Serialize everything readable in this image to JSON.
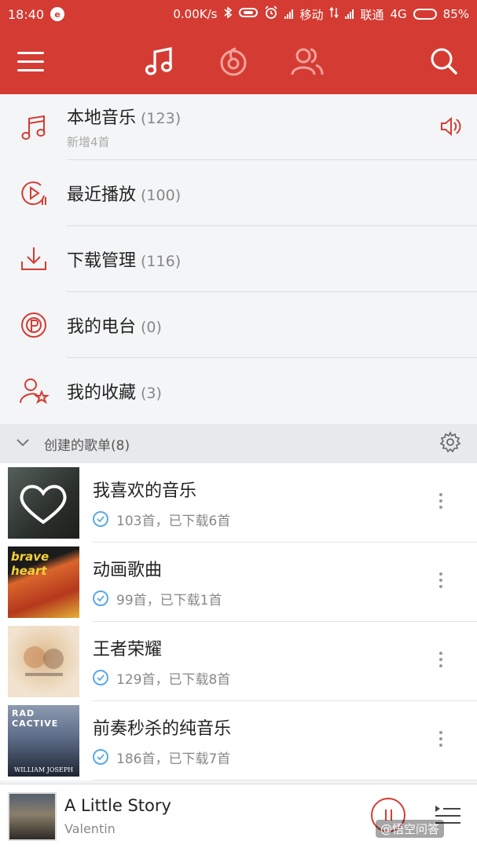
{
  "status_bar": {
    "time": "18:40",
    "netease_badge": "e",
    "speed": "0.00K/s",
    "carrier1": "移动",
    "carrier2": "联通",
    "network": "4G",
    "battery": "85%",
    "battery_level": 0.85
  },
  "header": {
    "tabs": [
      "music-note-icon",
      "netease-logo-icon",
      "friends-icon"
    ]
  },
  "my_music": [
    {
      "title": "本地音乐",
      "count": "(123)",
      "sub": "新增4首",
      "icon": "music-note-icon"
    },
    {
      "title": "最近播放",
      "count": "(100)",
      "sub": "",
      "icon": "recent-play-icon"
    },
    {
      "title": "下载管理",
      "count": "(116)",
      "sub": "",
      "icon": "download-icon"
    },
    {
      "title": "我的电台",
      "count": "(0)",
      "sub": "",
      "icon": "radio-icon"
    },
    {
      "title": "我的收藏",
      "count": "(3)",
      "sub": "",
      "icon": "favorite-user-icon"
    }
  ],
  "created_playlists": {
    "label": "创建的歌单(8)",
    "items": [
      {
        "name": "我喜欢的音乐",
        "meta": "103首，已下载6首",
        "cover_color": "#3a3f3a"
      },
      {
        "name": "动画歌曲",
        "meta": "99首，已下载1首",
        "cover_color": "#c2461f"
      },
      {
        "name": "王者荣耀",
        "meta": "129首，已下载8首",
        "cover_color": "#e9d8c0"
      },
      {
        "name": "前奏秒杀的纯音乐",
        "meta": "186首，已下载7首",
        "cover_color": "#4b5a72"
      }
    ],
    "cover_texts": {
      "brave_heart": "brave heart",
      "rad_cactive": "RAD CACTIVE",
      "william_joseph": "WILLIAM JOSEPH"
    }
  },
  "player": {
    "title": "A Little Story",
    "artist": "Valentin"
  },
  "watermark": "@悟空问答",
  "colors": {
    "accent": "#d43c33",
    "check": "#5aa9e6"
  }
}
